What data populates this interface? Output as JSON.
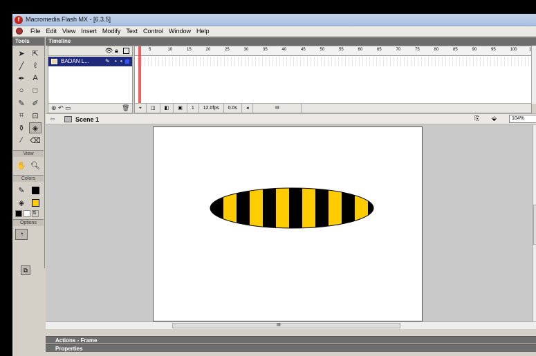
{
  "window": {
    "title": "Macromedia Flash MX - [6.3.5]"
  },
  "menu": [
    "File",
    "Edit",
    "View",
    "Insert",
    "Modify",
    "Text",
    "Control",
    "Window",
    "Help"
  ],
  "tools_panel": {
    "title": "Tools",
    "view_label": "View",
    "colors_label": "Colors",
    "options_label": "Options"
  },
  "timeline": {
    "title": "Timeline",
    "layer_name": "BADAN L...",
    "ruler_ticks": [
      "5",
      "10",
      "15",
      "20",
      "25",
      "30",
      "35",
      "40",
      "45",
      "50",
      "55",
      "60",
      "65",
      "70",
      "75",
      "80",
      "85",
      "90",
      "95",
      "100",
      "1"
    ],
    "current_frame": "1",
    "frame_rate": "12.0fps",
    "elapsed": "0.0s",
    "scroll_mark": "III"
  },
  "scene": {
    "label": "Scene 1",
    "zoom": "104%"
  },
  "stage": {
    "hscroll_mark": "III"
  },
  "panels": {
    "actions": "Actions - Frame",
    "properties": "Properties"
  },
  "colors": {
    "stroke": "#000000",
    "fill": "#ffcc00",
    "stage": "#ffffff"
  }
}
